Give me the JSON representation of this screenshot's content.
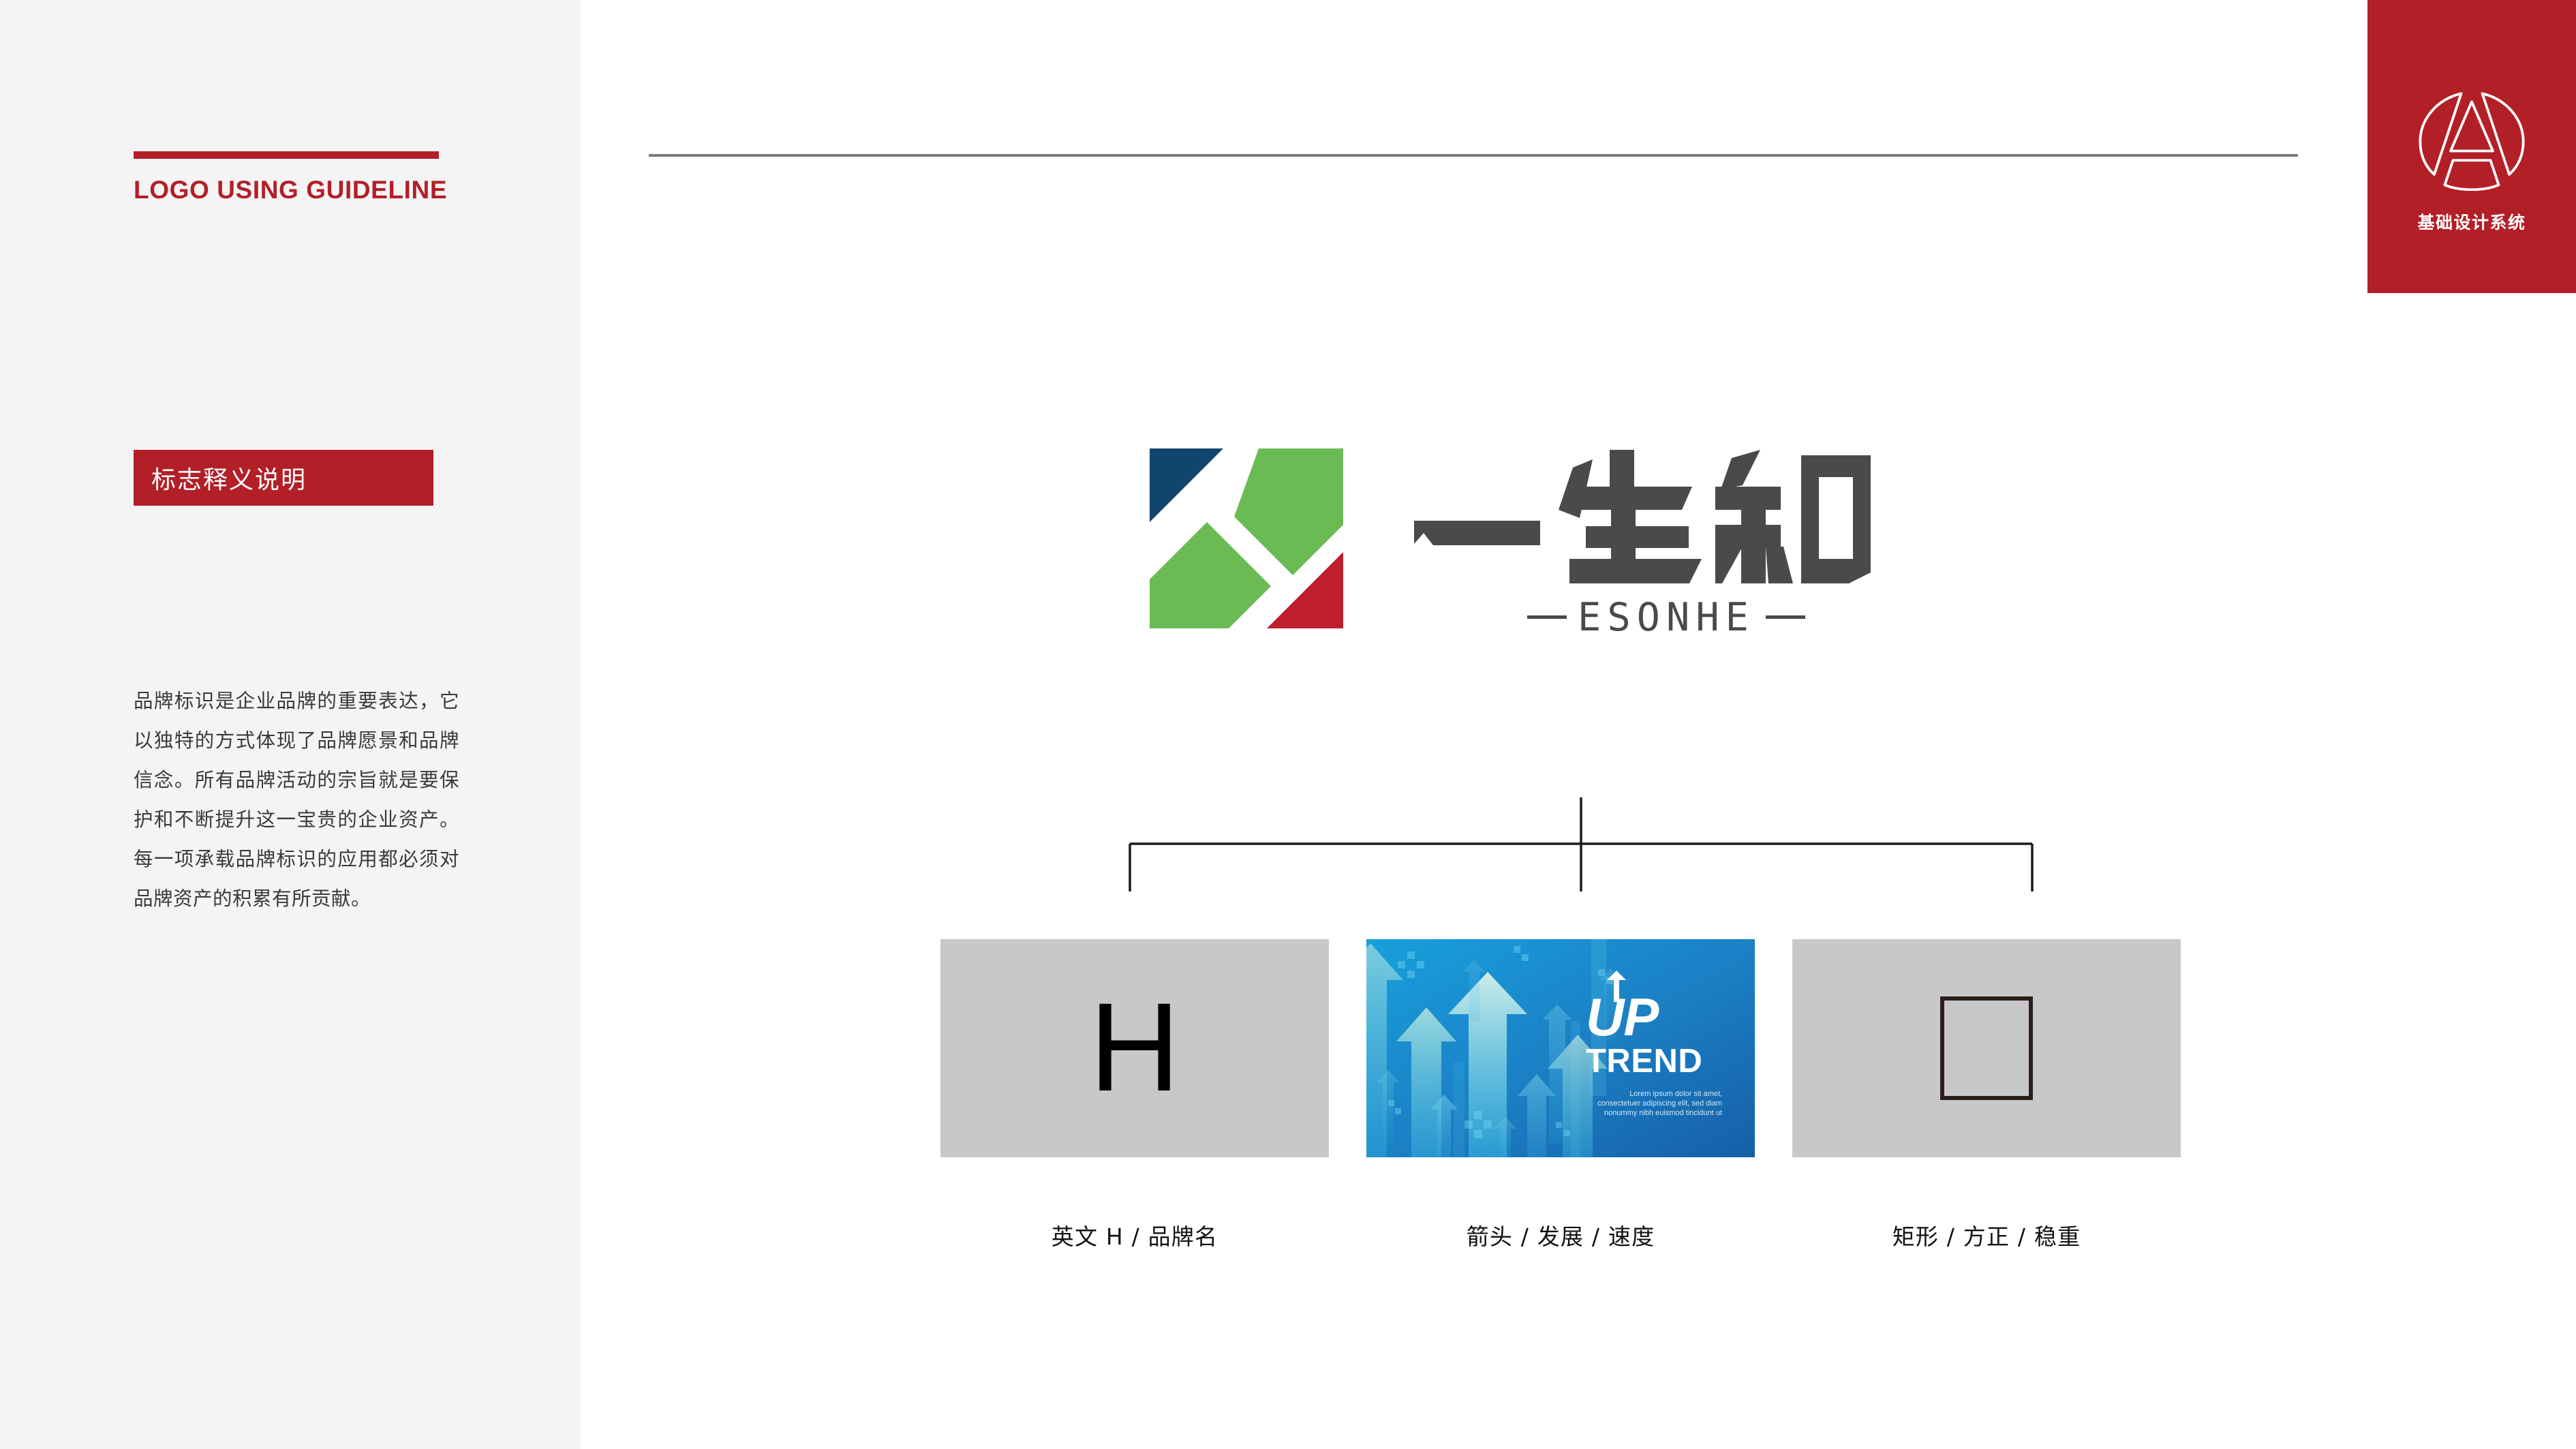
{
  "sidebar": {
    "guideline_title": "LOGO USING GUIDELINE",
    "section_badge_label": "标志释义说明",
    "paragraph": "品牌标识是企业品牌的重要表达，它以独特的方式体现了品牌愿景和品牌信念。所有品牌活动的宗旨就是要保护和不断提升这一宝贵的企业资产。每一项承载品牌标识的应用都必须对品牌资产的积累有所贡献。"
  },
  "header": {
    "corner_badge_label": "基础设计系统",
    "corner_badge_icon": "a-monogram-circle-icon"
  },
  "logo": {
    "wordmark_cn": "一生和",
    "wordmark_en": "ESONHE",
    "colors": {
      "navy": "#11456c",
      "green": "#6bbb55",
      "red": "#bf1e2e",
      "wordmark_gray": "#4a4a4a"
    }
  },
  "brand": {
    "accent_red": "#b31f27",
    "sidebar_bg": "#f5f4f5",
    "rule_gray": "#7a7a7a",
    "card_bg": "#c8c8c8"
  },
  "elements": [
    {
      "id": "letter-h",
      "type": "letter",
      "value": "H",
      "caption": "英文 H / 品牌名"
    },
    {
      "id": "up-trend",
      "type": "image",
      "headline": "UP",
      "subhead": "TREND",
      "lorem": "Lorem ipsum dolor sit amet, consectetuer adipiscing elit, sed diam nonummy nibh euismod tincidunt ut",
      "caption": "箭头 / 发展 / 速度"
    },
    {
      "id": "square",
      "type": "shape",
      "shape": "rectangle-outline",
      "caption": "矩形 / 方正 / 稳重"
    }
  ]
}
